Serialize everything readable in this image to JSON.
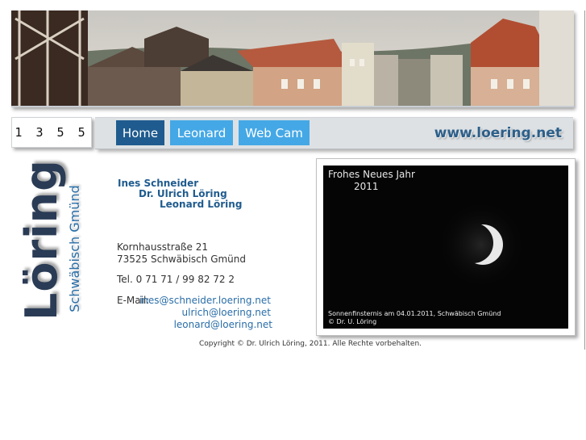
{
  "counter": "1355",
  "nav": {
    "items": [
      {
        "label": "Home",
        "active": true
      },
      {
        "label": "Leonard",
        "active": false
      },
      {
        "label": "Web Cam",
        "active": false
      }
    ],
    "site_url": "www.loering.net"
  },
  "logo": {
    "name": "Löring",
    "city": "Schwäbisch Gmünd"
  },
  "contact": {
    "names": [
      "Ines Schneider",
      "Dr. Ulrich Löring",
      "Leonard Löring"
    ],
    "street": "Kornhausstraße 21",
    "city": "73525 Schwäbisch Gmünd",
    "phone": "Tel. 0 71 71 / 99 82 72 2",
    "email_label": "E-Mail:",
    "emails": [
      "ines@schneider.loering.net",
      "ulrich@loering.net",
      "leonard@loering.net"
    ]
  },
  "photo": {
    "title_line1": "Frohes Neues Jahr",
    "title_line2": "2011",
    "caption_line1": "Sonnenfinsternis am 04.01.2011, Schwäbisch Gmünd",
    "caption_line2": "© Dr. U. Löring"
  },
  "footer": {
    "copyright": "Copyright © Dr. Ulrich Löring, 2011. Alle Rechte vorbehalten."
  },
  "colors": {
    "nav_active": "#1f5b8e",
    "nav_inactive": "#45a8e6",
    "link": "#2a6ea8",
    "accent_dark": "#2a3b55"
  }
}
